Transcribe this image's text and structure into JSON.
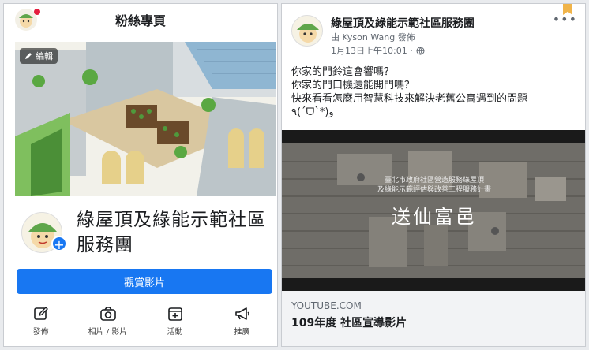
{
  "left": {
    "header_title": "粉絲專頁",
    "edit_label": "編輯",
    "page_name": "綠屋頂及綠能示範社區服務團",
    "watch_button": "觀賞影片",
    "actions": [
      {
        "label": "發佈",
        "icon": "pencil-icon"
      },
      {
        "label": "相片 / 影片",
        "icon": "camera-icon"
      },
      {
        "label": "活動",
        "icon": "calendar-plus-icon"
      },
      {
        "label": "推廣",
        "icon": "megaphone-icon"
      }
    ]
  },
  "right": {
    "page_name": "綠屋頂及綠能示範社區服務團",
    "published_by": "由 Kyson Wang 發佈",
    "time": "1月13日上午10:01 ·",
    "body_lines": [
      "你家的門鈴這會響嗎？",
      "你家的門口機還能開門嗎？",
      "快來看看怎麼用智慧科技來解決老舊公寓遇到的問題",
      "٩(ˊᗜˋ*)و"
    ],
    "video_caption_small": "臺北市政府社區營造服務綠屋頂",
    "video_caption_small2": "及綠能示範評估與改善工程服務計畫",
    "video_title": "送仙富邑",
    "link_source": "YOUTUBE.COM",
    "link_title": "109年度 社區宣導影片"
  },
  "colors": {
    "accent": "#1877f2",
    "dark": "#1c1e21",
    "muted": "#606770"
  }
}
